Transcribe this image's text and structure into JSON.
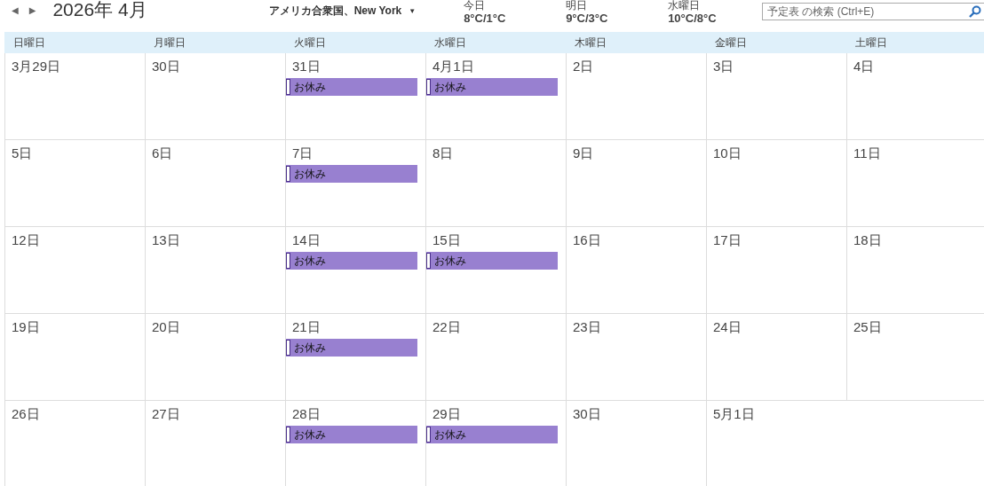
{
  "header": {
    "prev": "◀",
    "next": "▶",
    "title": "2026年 4月",
    "location": "アメリカ合衆国、New York",
    "location_caret": "▼"
  },
  "weather": [
    {
      "label": "今日",
      "temp": "8°C/1°C"
    },
    {
      "label": "明日",
      "temp": "9°C/3°C"
    },
    {
      "label": "水曜日",
      "temp": "10°C/8°C"
    }
  ],
  "search": {
    "placeholder": "予定表 の検索 (Ctrl+E)"
  },
  "weekdays": [
    "日曜日",
    "月曜日",
    "火曜日",
    "水曜日",
    "木曜日",
    "金曜日",
    "土曜日"
  ],
  "weeks": [
    [
      {
        "date": "3月29日"
      },
      {
        "date": "30日"
      },
      {
        "date": "31日",
        "events": [
          "お休み"
        ]
      },
      {
        "date": "4月1日",
        "events": [
          "お休み"
        ]
      },
      {
        "date": "2日"
      },
      {
        "date": "3日"
      },
      {
        "date": "4日"
      }
    ],
    [
      {
        "date": "5日"
      },
      {
        "date": "6日"
      },
      {
        "date": "7日",
        "events": [
          "お休み"
        ]
      },
      {
        "date": "8日"
      },
      {
        "date": "9日"
      },
      {
        "date": "10日"
      },
      {
        "date": "11日"
      }
    ],
    [
      {
        "date": "12日"
      },
      {
        "date": "13日"
      },
      {
        "date": "14日",
        "events": [
          "お休み"
        ]
      },
      {
        "date": "15日",
        "events": [
          "お休み"
        ]
      },
      {
        "date": "16日"
      },
      {
        "date": "17日"
      },
      {
        "date": "18日"
      }
    ],
    [
      {
        "date": "19日"
      },
      {
        "date": "20日"
      },
      {
        "date": "21日",
        "events": [
          "お休み"
        ]
      },
      {
        "date": "22日"
      },
      {
        "date": "23日"
      },
      {
        "date": "24日"
      },
      {
        "date": "25日"
      }
    ],
    [
      {
        "date": "26日"
      },
      {
        "date": "27日"
      },
      {
        "date": "28日",
        "events": [
          "お休み"
        ]
      },
      {
        "date": "29日",
        "events": [
          "お休み"
        ]
      },
      {
        "date": "30日"
      },
      {
        "date": "5月1日"
      }
    ]
  ]
}
